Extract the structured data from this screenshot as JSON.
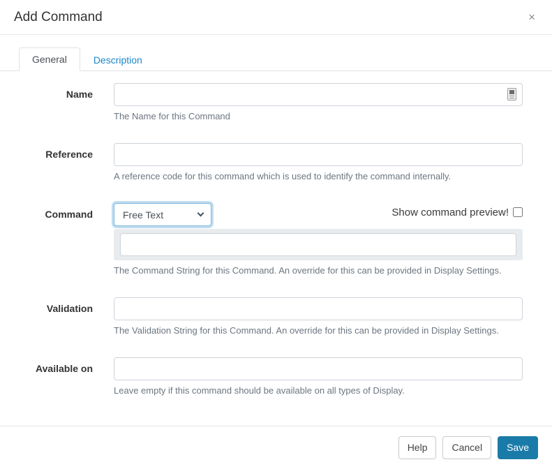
{
  "modal": {
    "title": "Add Command",
    "close_icon": "×"
  },
  "tabs": [
    {
      "label": "General",
      "active": true
    },
    {
      "label": "Description",
      "active": false
    }
  ],
  "form": {
    "name": {
      "label": "Name",
      "value": "",
      "help": "The Name for this Command"
    },
    "reference": {
      "label": "Reference",
      "value": "",
      "help": "A reference code for this command which is used to identify the command internally."
    },
    "command": {
      "label": "Command",
      "type_selected": "Free Text",
      "preview_label": "Show command preview!",
      "preview_checked": false,
      "value": "",
      "help": "The Command String for this Command. An override for this can be provided in Display Settings."
    },
    "validation": {
      "label": "Validation",
      "value": "",
      "help": "The Validation String for this Command. An override for this can be provided in Display Settings."
    },
    "available_on": {
      "label": "Available on",
      "value": "",
      "help": "Leave empty if this command should be available on all types of Display."
    }
  },
  "footer": {
    "help_label": "Help",
    "cancel_label": "Cancel",
    "save_label": "Save"
  },
  "colors": {
    "primary_button": "#1a7ba8",
    "tab_link": "#1e88c8",
    "input_border": "#ced4da",
    "help_text": "#6c7680",
    "command_wrap_bg": "#e9ecef"
  }
}
